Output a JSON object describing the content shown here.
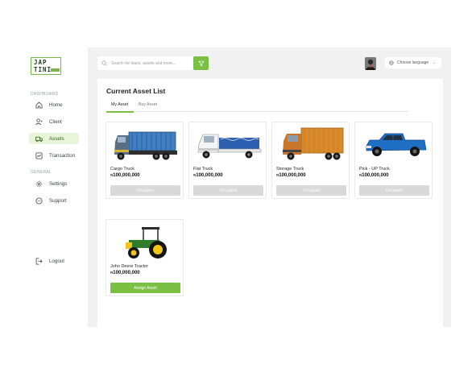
{
  "brand": {
    "logo_line1": "JAP",
    "logo_line2": "TINI"
  },
  "sidebar": {
    "section_dashboard": "DASHBOARD",
    "section_general": "GENERAL",
    "items": [
      {
        "label": "Home",
        "icon": "home-icon"
      },
      {
        "label": "Client",
        "icon": "user-icon"
      },
      {
        "label": "Assets",
        "icon": "truck-icon",
        "active": true
      },
      {
        "label": "Transaction",
        "icon": "transaction-icon"
      }
    ],
    "general_items": [
      {
        "label": "Settings",
        "icon": "gear-icon"
      },
      {
        "label": "Support",
        "icon": "chat-icon"
      }
    ],
    "logout_label": "Logout"
  },
  "header": {
    "search_placeholder": "Search for loans, assets and more...",
    "language_label": "Choose language"
  },
  "page": {
    "title": "Current Asset List",
    "tabs": [
      {
        "label": "My Asset",
        "active": true
      },
      {
        "label": "Buy Asset"
      }
    ]
  },
  "assets": [
    {
      "name": "Cargo Truck",
      "currency": "₦",
      "price": "100,000,000",
      "status": "Occupied",
      "image": "cargo-truck"
    },
    {
      "name": "Flat Truck",
      "currency": "₦",
      "price": "100,000,000",
      "status": "Occupied",
      "image": "flat-truck"
    },
    {
      "name": "Storage Truck",
      "currency": "₦",
      "price": "100,000,000",
      "status": "Occupied",
      "image": "storage-truck"
    },
    {
      "name": "Pick - UP Truck",
      "currency": "₦",
      "price": "100,000,000",
      "status": "Occupied",
      "image": "pickup-truck"
    },
    {
      "name": "John Deere Tractor",
      "currency": "₦",
      "price": "100,000,000",
      "action": "Assign Asset",
      "image": "tractor"
    }
  ],
  "colors": {
    "accent": "#7ac043",
    "active_bg": "#e8f5d9",
    "occupied": "#d9d9d9",
    "panel_bg": "#f1f1f1"
  }
}
